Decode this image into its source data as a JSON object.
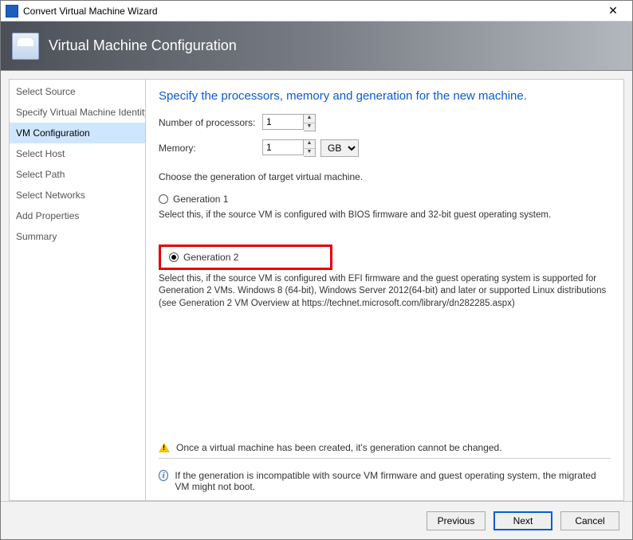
{
  "window": {
    "title": "Convert Virtual Machine Wizard"
  },
  "header": {
    "title": "Virtual Machine Configuration"
  },
  "sidebar": {
    "items": [
      "Select Source",
      "Specify Virtual Machine Identity",
      "VM Configuration",
      "Select Host",
      "Select Path",
      "Select Networks",
      "Add Properties",
      "Summary"
    ],
    "active_index": 2
  },
  "content": {
    "heading": "Specify the processors, memory and generation for the new machine.",
    "processors_label": "Number of processors:",
    "processors_value": "1",
    "memory_label": "Memory:",
    "memory_value": "1",
    "memory_unit": "GB",
    "choose_text": "Choose the generation of target virtual machine.",
    "gen1_label": "Generation 1",
    "gen1_desc": "Select this, if the source VM is configured with BIOS firmware and 32-bit guest operating system.",
    "gen2_label": "Generation 2",
    "gen2_desc": "Select this, if the source VM is configured with EFI firmware and the guest operating system is supported for Generation 2 VMs. Windows 8 (64-bit), Windows Server 2012(64-bit) and later or supported Linux distributions (see Generation 2 VM Overview at https://technet.microsoft.com/library/dn282285.aspx)",
    "selected_generation": "gen2",
    "warn_text": "Once a virtual machine has been created, it's generation cannot be changed.",
    "info_text": "If the generation is incompatible with source VM firmware and guest operating system, the migrated VM might not boot."
  },
  "footer": {
    "previous": "Previous",
    "next": "Next",
    "cancel": "Cancel"
  }
}
